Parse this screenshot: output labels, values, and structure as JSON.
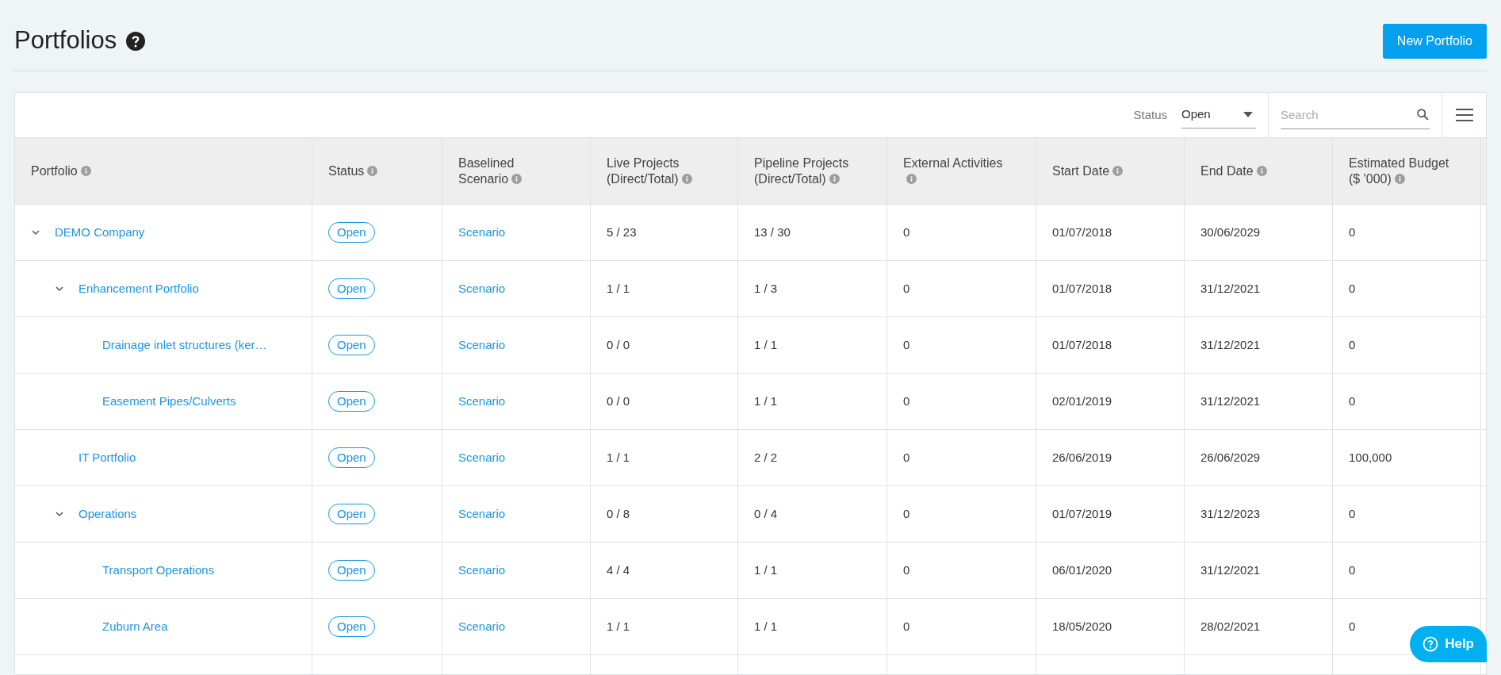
{
  "page": {
    "title": "Portfolios",
    "new_button": "New Portfolio"
  },
  "toolbar": {
    "status_label": "Status",
    "status_value": "Open",
    "search_placeholder": "Search"
  },
  "columns": [
    "Portfolio",
    "Status",
    "Baselined Scenario",
    "Live Projects (Direct/Total)",
    "Pipeline Projects (Direct/Total)",
    "External Activities",
    "Start Date",
    "End Date",
    "Estimated Budget ($ '000)"
  ],
  "rows": [
    {
      "name": "DEMO Company",
      "status": "Open",
      "scenario": "Scenario",
      "live": "5 / 23",
      "pipeline": "13 / 30",
      "external": "0",
      "start": "01/07/2018",
      "end": "30/06/2029",
      "budget": "0",
      "expanded": true,
      "children": [
        {
          "name": "Enhancement Portfolio",
          "status": "Open",
          "scenario": "Scenario",
          "live": "1 / 1",
          "pipeline": "1 / 3",
          "external": "0",
          "start": "01/07/2018",
          "end": "31/12/2021",
          "budget": "0",
          "expanded": true,
          "children": [
            {
              "name": "Drainage inlet structures (ker…",
              "status": "Open",
              "scenario": "Scenario",
              "live": "0 / 0",
              "pipeline": "1 / 1",
              "external": "0",
              "start": "01/07/2018",
              "end": "31/12/2021",
              "budget": "0"
            },
            {
              "name": "Easement Pipes/Culverts",
              "status": "Open",
              "scenario": "Scenario",
              "live": "0 / 0",
              "pipeline": "1 / 1",
              "external": "0",
              "start": "02/01/2019",
              "end": "31/12/2021",
              "budget": "0"
            }
          ]
        },
        {
          "name": "IT Portfolio",
          "status": "Open",
          "scenario": "Scenario",
          "live": "1 / 1",
          "pipeline": "2 / 2",
          "external": "0",
          "start": "26/06/2019",
          "end": "26/06/2029",
          "budget": "100,000"
        },
        {
          "name": "Operations",
          "status": "Open",
          "scenario": "Scenario",
          "live": "0 / 8",
          "pipeline": "0 / 4",
          "external": "0",
          "start": "01/07/2019",
          "end": "31/12/2023",
          "budget": "0",
          "expanded": true,
          "children": [
            {
              "name": "Transport Operations",
              "status": "Open",
              "scenario": "Scenario",
              "live": "4 / 4",
              "pipeline": "1 / 1",
              "external": "0",
              "start": "06/01/2020",
              "end": "31/12/2021",
              "budget": "0"
            },
            {
              "name": "Zuburn Area",
              "status": "Open",
              "scenario": "Scenario",
              "live": "1 / 1",
              "pipeline": "1 / 1",
              "external": "0",
              "start": "18/05/2020",
              "end": "28/02/2021",
              "budget": "0"
            }
          ]
        }
      ]
    }
  ],
  "help_button": "Help"
}
